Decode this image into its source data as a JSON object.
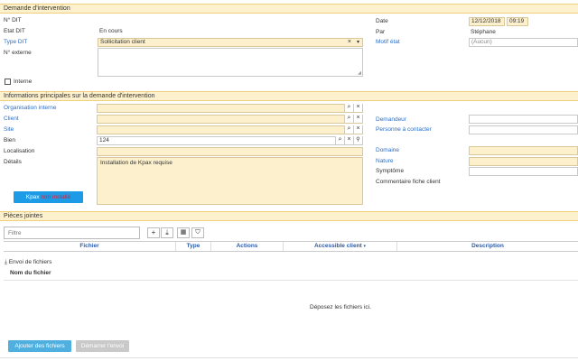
{
  "sections": {
    "demande": "Demande d'intervention",
    "infos": "Informations principales sur la demande d'intervention",
    "pieces": "Pièces jointes"
  },
  "demande": {
    "num_label": "N° DIT",
    "etat_label": "Etat DIT",
    "etat_value": "En cours",
    "type_label": "Type DIT",
    "type_value": "Sollicitation client",
    "externe_label": "N° externe",
    "interne_label": "Interne",
    "date_label": "Date",
    "date_value": "12/12/2018",
    "time_value": "09:19",
    "par_label": "Par",
    "par_value": "Stéphane",
    "motif_label": "Motif état",
    "motif_value": "(Aucun)"
  },
  "infos": {
    "org_label": "Organisation interne",
    "client_label": "Client",
    "site_label": "Site",
    "bien_label": "Bien",
    "bien_value": "124",
    "loc_label": "Localisation",
    "details_label": "Détails",
    "details_value": "Installation de Kpax requise",
    "demandeur_label": "Demandeur",
    "personne_label": "Personne à contacter",
    "domaine_label": "Domaine",
    "nature_label": "Nature",
    "symptome_label": "Symptôme",
    "commentaire_label": "Commentaire fiche client",
    "kpax_a": "Kpax ",
    "kpax_b": "non installé"
  },
  "pieces": {
    "filter_placeholder": "Filtre",
    "columns": [
      "Fichier",
      "Type",
      "Actions",
      "Accessible client",
      "Description"
    ],
    "envoi_label": "Envoi de fichiers",
    "nom_label": "Nom du fichier",
    "drop_text": "Déposez les fichiers ici.",
    "add_button": "Ajouter des fichiers",
    "send_button": "Démarrer l'envoi"
  },
  "icons": {
    "search": "search-icon",
    "clear": "clear-icon",
    "hierarchy": "hierarchy-icon",
    "plus": "plus-icon",
    "download": "download-icon",
    "grid": "grid-icon",
    "filter": "filter-icon"
  },
  "colors": {
    "section_bg": "#fdf0cc",
    "field_bg": "#fdf0cc",
    "link": "#2a6fc9",
    "kpax_button": "#1e9be6",
    "kpax_warn": "#e0203a",
    "add_button": "#4fb0e0"
  }
}
